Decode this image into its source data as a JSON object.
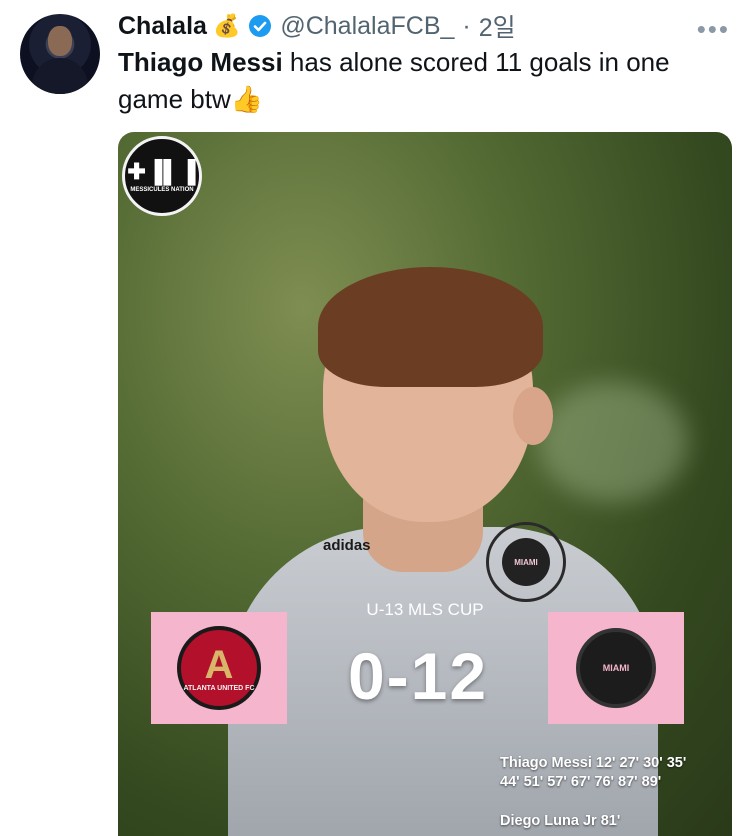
{
  "tweet": {
    "author_name": "Chalala",
    "author_emoji": "💰",
    "handle": "@ChalalaFCB_",
    "separator": "·",
    "time": "2일",
    "more_label": "•••",
    "text_bold": "Thiago Messi",
    "text_rest": " has alone scored 11 goals in one game btw",
    "text_emoji": "👍"
  },
  "media": {
    "badge_text": "MESSICULES NATION",
    "badge_symbol": "✚▐▌▐",
    "shirt_brand": "adidas",
    "crest_text": "MIAMI",
    "cup_title": "U-13 MLS CUP",
    "score": "0-12",
    "left_team": {
      "letter": "A",
      "text": "ATLANTA UNITED FC",
      "color": "#b3102c"
    },
    "right_team": {
      "text": "MIAMI",
      "color": "#1c1c1c"
    },
    "box_color": "#f5b5cc",
    "scorer1_line1": "Thiago Messi 12' 27' 30' 35'",
    "scorer1_line2": "44' 51' 57' 67' 76' 87' 89'",
    "scorer2": "Diego Luna Jr 81'"
  },
  "colors": {
    "verified": "#1d9bf0",
    "handle": "#536471"
  }
}
